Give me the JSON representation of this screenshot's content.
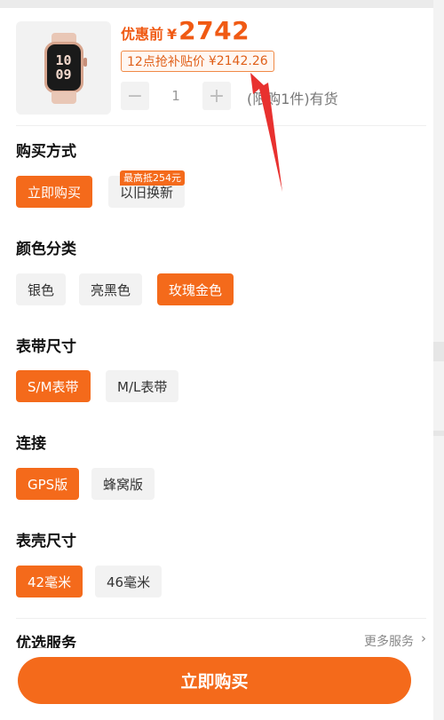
{
  "product": {
    "image": {
      "icon": "apple-watch-product-image",
      "clock_top": "10",
      "clock_bottom": "09"
    },
    "price_label": "优惠前",
    "currency": "¥",
    "price": "2742",
    "subsidy_label": "12点抢补贴价",
    "subsidy_price": "¥2142.26",
    "quantity": "1",
    "minus_icon": "−",
    "plus_icon": "+",
    "stock_note": "(限购1件)有货"
  },
  "purchase_method": {
    "title": "购买方式",
    "options": [
      {
        "label": "立即购买",
        "selected": true
      },
      {
        "label": "以旧换新",
        "selected": false
      }
    ],
    "tradein_badge": "最高抵254元"
  },
  "color": {
    "title": "颜色分类",
    "options": [
      {
        "label": "银色",
        "selected": false
      },
      {
        "label": "亮黑色",
        "selected": false
      },
      {
        "label": "玫瑰金色",
        "selected": true
      }
    ]
  },
  "band_size": {
    "title": "表带尺寸",
    "options": [
      {
        "label": "S/M表带",
        "selected": true
      },
      {
        "label": "M/L表带",
        "selected": false
      }
    ]
  },
  "connectivity": {
    "title": "连接",
    "options": [
      {
        "label": "GPS版",
        "selected": true
      },
      {
        "label": "蜂窝版",
        "selected": false
      }
    ]
  },
  "case_size": {
    "title": "表壳尺寸",
    "options": [
      {
        "label": "42毫米",
        "selected": true
      },
      {
        "label": "46毫米",
        "selected": false
      }
    ]
  },
  "services": {
    "title": "优选服务",
    "more_label": "更多服务",
    "chevron": "›"
  },
  "cta": {
    "label": "立即购买"
  },
  "colors": {
    "accent": "#f46a1b",
    "annotation_arrow": "#e8312f"
  }
}
